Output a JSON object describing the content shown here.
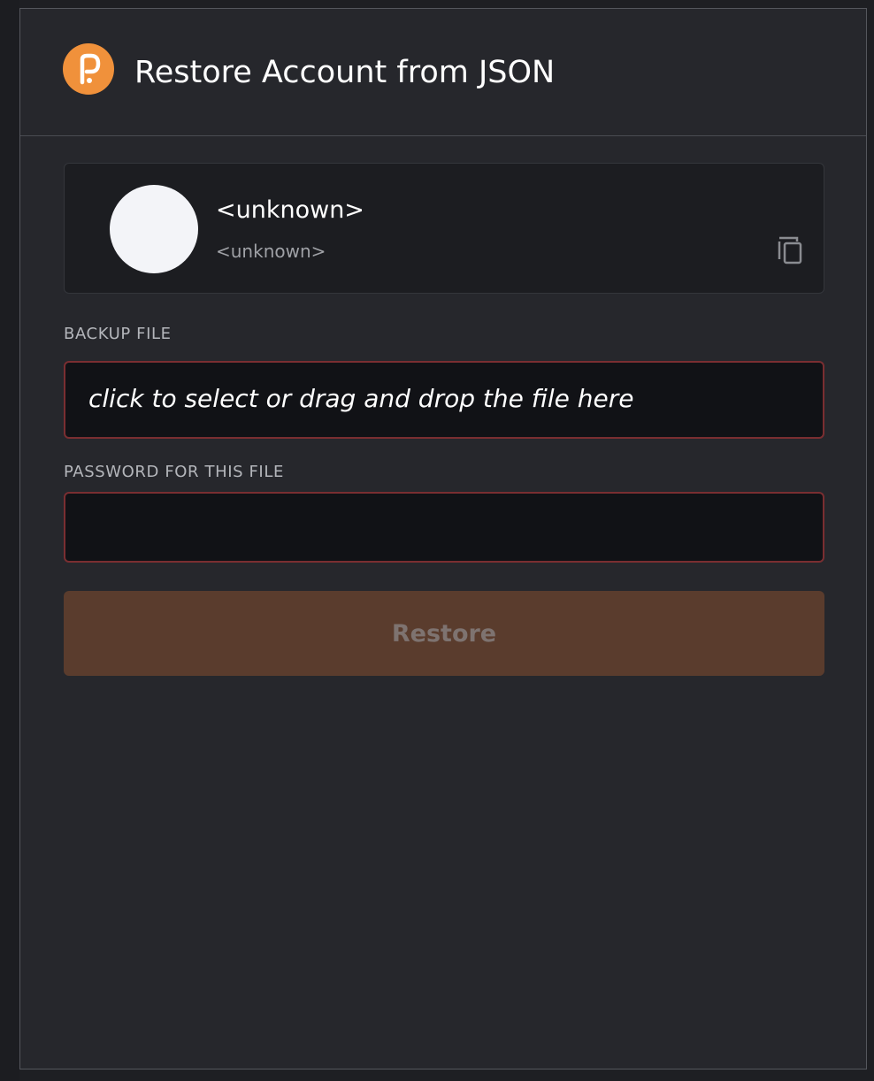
{
  "header": {
    "title": "Restore Account from JSON",
    "logo_icon": "polkadot-logo-icon"
  },
  "account": {
    "name": "<unknown>",
    "address": "<unknown>",
    "copy_icon": "copy-icon"
  },
  "backup_file": {
    "label": "BACKUP FILE",
    "placeholder": "click to select or drag and drop the file here"
  },
  "password": {
    "label": "PASSWORD FOR THIS FILE",
    "value": ""
  },
  "restore_button": {
    "label": "Restore",
    "disabled": true
  },
  "colors": {
    "accent": "#f0913b",
    "panel_bg": "#26272c",
    "card_bg": "#1c1d21",
    "input_bg": "#111216",
    "error_border": "#7a2e31",
    "button_disabled_bg": "#5a3c2d"
  }
}
